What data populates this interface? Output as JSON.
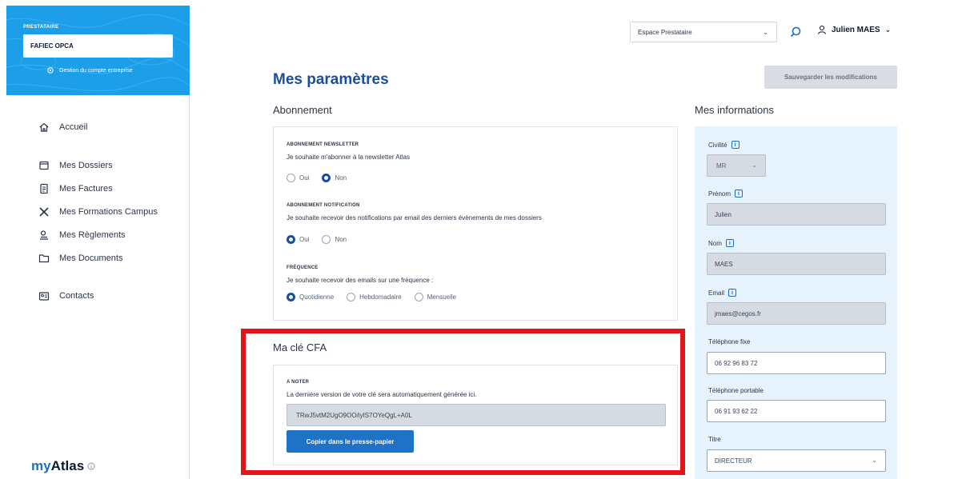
{
  "sidebar": {
    "role": "PRESTATAIRE",
    "company": "FAFIEC OPCA",
    "manage_link": "Gestion du compte entreprise",
    "items": [
      {
        "label": "Accueil",
        "icon": "home-icon"
      },
      {
        "label": "Mes Dossiers",
        "icon": "folder-tray-icon"
      },
      {
        "label": "Mes Factures",
        "icon": "invoice-icon"
      },
      {
        "label": "Mes Formations Campus",
        "icon": "campus-icon"
      },
      {
        "label": "Mes Règlements",
        "icon": "payment-icon"
      },
      {
        "label": "Mes Documents",
        "icon": "documents-folder-icon"
      },
      {
        "label": "Contacts",
        "icon": "contacts-icon"
      }
    ],
    "brand_my": "my",
    "brand_atlas": "Atlas"
  },
  "header": {
    "espace_select": "Espace Prestataire",
    "user_name": "Julien MAES"
  },
  "page": {
    "title": "Mes paramètres",
    "save_label": "Sauvegarder les modifications"
  },
  "subscription": {
    "section_title": "Abonnement",
    "newsletter": {
      "caption": "ABONNEMENT NEWSLETTER",
      "question": "Je souhaite m'abonner à la newsletter Atlas",
      "options": [
        "Oui",
        "Non"
      ],
      "selected": "Non"
    },
    "notification": {
      "caption": "ABONNEMENT NOTIFICATION",
      "question": "Je souhaite recevoir des notifications par email des derniers évènements de mes dossiers",
      "options": [
        "Oui",
        "Non"
      ],
      "selected": "Oui"
    },
    "frequency": {
      "caption": "FRÉQUENCE",
      "question": "Je souhaite recevoir des emails sur une fréquence :",
      "options": [
        "Quotidienne",
        "Hebdomadaire",
        "Mensuelle"
      ],
      "selected": "Quotidienne"
    }
  },
  "cfa": {
    "section_title": "Ma clé CFA",
    "caption": "A NOTER",
    "note": "La dernière version de votre clé sera automatiquement générée ici.",
    "key": "TRwJ5vtM2UgO9OO/iyIS7OYeQgL+A0L",
    "copy_label": "Copier dans le presse-papier"
  },
  "info": {
    "section_title": "Mes informations",
    "civilite_label": "Civilité",
    "civilite_value": "MR",
    "prenom_label": "Prénom",
    "prenom_value": "Julien",
    "nom_label": "Nom",
    "nom_value": "MAES",
    "email_label": "Email",
    "email_value": "jmaes@cegos.fr",
    "tel_fixe_label": "Téléphone fixe",
    "tel_fixe_value": "06 92 96 83 72",
    "tel_portable_label": "Téléphone portable",
    "tel_portable_value": "06 91 93 62 22",
    "titre_label": "Titre",
    "titre_value": "DIRECTEUR",
    "info_glyph": "i"
  },
  "colors": {
    "sidebar_header": "#1d9ee8",
    "title_blue": "#1a4d9c",
    "primary_button": "#1e73c8",
    "highlight_red": "#e4141b",
    "info_panel": "#e6f3fc"
  }
}
